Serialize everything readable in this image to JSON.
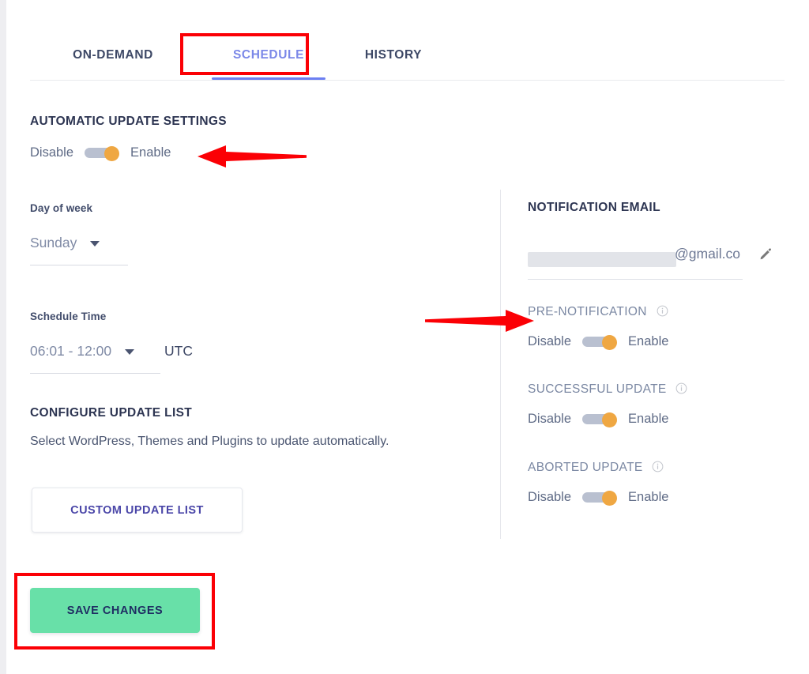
{
  "tabs": [
    {
      "label": "ON-DEMAND",
      "active": false
    },
    {
      "label": "SCHEDULE",
      "active": true
    },
    {
      "label": "HISTORY",
      "active": false
    }
  ],
  "left": {
    "section_title": "AUTOMATIC UPDATE SETTINGS",
    "auto_update_toggle": {
      "off_label": "Disable",
      "on_label": "Enable",
      "state": "on"
    },
    "day_of_week": {
      "label": "Day of week",
      "value": "Sunday"
    },
    "schedule_time": {
      "label": "Schedule Time",
      "value": "06:01 - 12:00",
      "timezone": "UTC"
    },
    "configure": {
      "title": "CONFIGURE UPDATE LIST",
      "description": "Select WordPress, Themes and Plugins to update automatically.",
      "button_label": "CUSTOM UPDATE LIST"
    }
  },
  "right": {
    "notification_email": {
      "title": "NOTIFICATION EMAIL",
      "value": "@gmail.co",
      "edit_icon": "pencil-icon"
    },
    "toggles": [
      {
        "title": "PRE-NOTIFICATION",
        "info_icon": "info-icon",
        "off_label": "Disable",
        "on_label": "Enable",
        "state": "on"
      },
      {
        "title": "SUCCESSFUL UPDATE",
        "info_icon": "info-icon",
        "off_label": "Disable",
        "on_label": "Enable",
        "state": "on"
      },
      {
        "title": "ABORTED UPDATE",
        "info_icon": "info-icon",
        "off_label": "Disable",
        "on_label": "Enable",
        "state": "on"
      }
    ]
  },
  "footer": {
    "save_label": "SAVE CHANGES"
  },
  "colors": {
    "active_tab": "#7b88e8",
    "tab_underline": "#6c7ff2",
    "toggle_knob": "#efa742",
    "toggle_track": "#b9c0d0",
    "save_button": "#68e0a8",
    "save_button_text": "#1f2d63",
    "outline_button_text": "#4a46a8",
    "heading": "#2d3552",
    "annotation": "#fb0005"
  }
}
